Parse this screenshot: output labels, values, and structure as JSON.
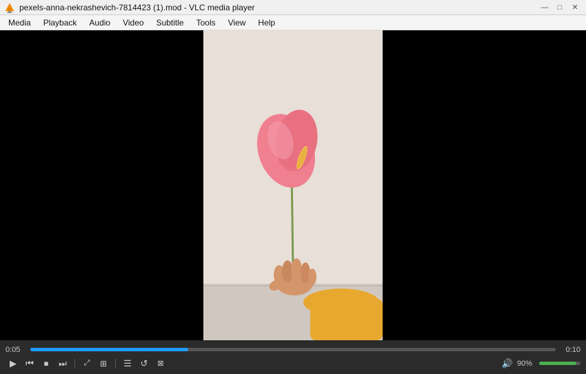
{
  "titlebar": {
    "title": "pexels-anna-nekrashevich-7814423 (1).mod - VLC media player",
    "icon": "vlc-icon",
    "controls": {
      "minimize": "—",
      "maximize": "□",
      "close": "✕"
    }
  },
  "menubar": {
    "items": [
      {
        "label": "Media",
        "id": "menu-media"
      },
      {
        "label": "Playback",
        "id": "menu-playback"
      },
      {
        "label": "Audio",
        "id": "menu-audio"
      },
      {
        "label": "Video",
        "id": "menu-video"
      },
      {
        "label": "Subtitle",
        "id": "menu-subtitle"
      },
      {
        "label": "Tools",
        "id": "menu-tools"
      },
      {
        "label": "View",
        "id": "menu-view"
      },
      {
        "label": "Help",
        "id": "menu-help"
      }
    ]
  },
  "player": {
    "time_current": "0:05",
    "time_total": "0:10",
    "seek_percent": 30,
    "volume_percent": 90,
    "volume_label": "90%"
  },
  "controls": {
    "play": "▶",
    "prev": "⏮",
    "stop": "⏹",
    "next": "⏭",
    "fullscreen": "⤢",
    "playlist": "☰",
    "loop": "↺",
    "extended": "⊞",
    "volume_icon": "🔊"
  }
}
